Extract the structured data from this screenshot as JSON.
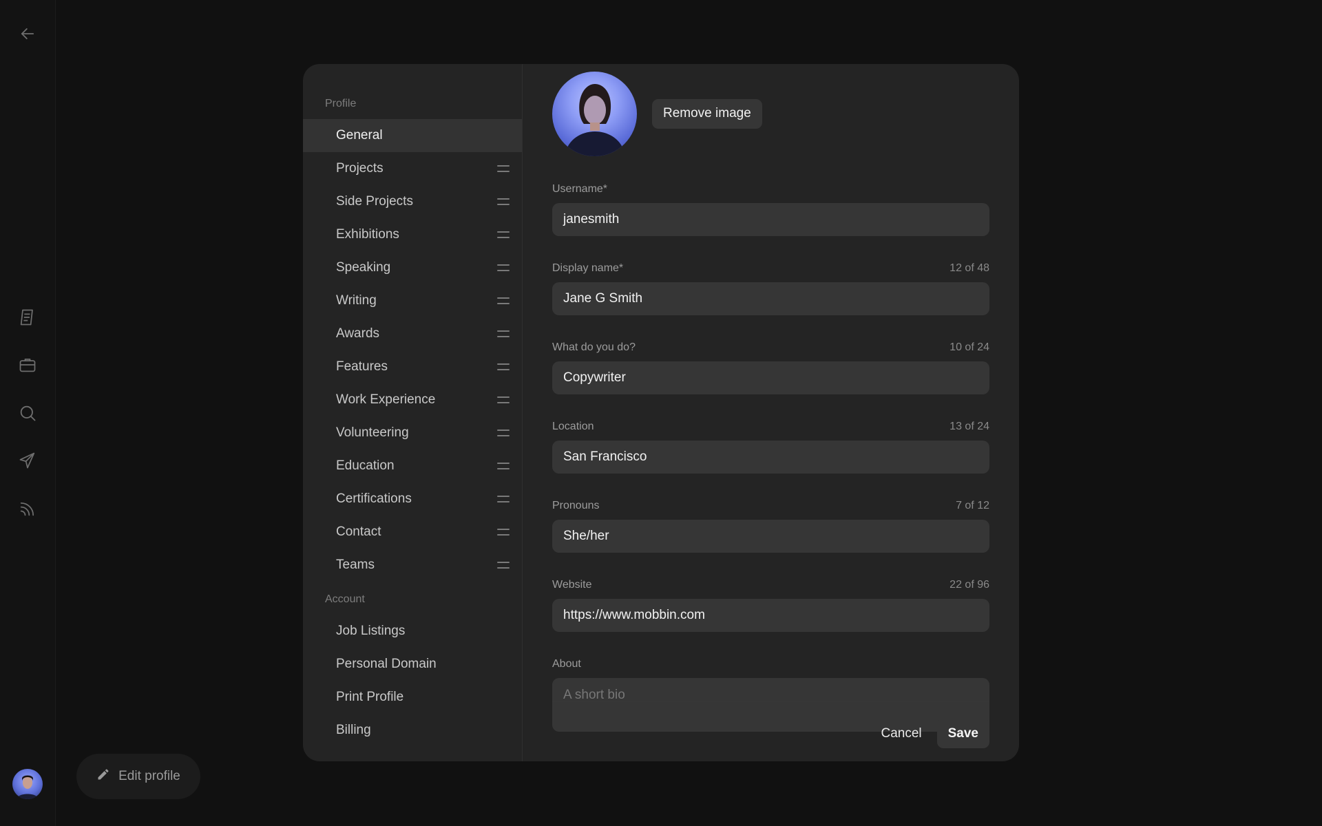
{
  "rail": {
    "icons": [
      "back-arrow-icon",
      "notes-icon",
      "briefcase-icon",
      "search-icon",
      "send-icon",
      "rss-icon"
    ]
  },
  "edit_profile": {
    "label": "Edit profile",
    "icon": "pencil-icon"
  },
  "sidebar": {
    "profile_heading": "Profile",
    "profile_items": [
      {
        "label": "General",
        "active": true
      },
      {
        "label": "Projects"
      },
      {
        "label": "Side Projects"
      },
      {
        "label": "Exhibitions"
      },
      {
        "label": "Speaking"
      },
      {
        "label": "Writing"
      },
      {
        "label": "Awards"
      },
      {
        "label": "Features"
      },
      {
        "label": "Work Experience"
      },
      {
        "label": "Volunteering"
      },
      {
        "label": "Education"
      },
      {
        "label": "Certifications"
      },
      {
        "label": "Contact"
      },
      {
        "label": "Teams"
      }
    ],
    "account_heading": "Account",
    "account_items": [
      {
        "label": "Job Listings"
      },
      {
        "label": "Personal Domain"
      },
      {
        "label": "Print Profile"
      },
      {
        "label": "Billing"
      }
    ]
  },
  "form": {
    "remove_image": "Remove image",
    "username": {
      "label": "Username*",
      "value": "janesmith"
    },
    "display_name": {
      "label": "Display name*",
      "count": "12 of 48",
      "value": "Jane G Smith"
    },
    "what_do_you_do": {
      "label": "What do you do?",
      "count": "10 of 24",
      "value": "Copywriter"
    },
    "location": {
      "label": "Location",
      "count": "13 of 24",
      "value": "San Francisco"
    },
    "pronouns": {
      "label": "Pronouns",
      "count": "7 of 12",
      "value": "She/her"
    },
    "website": {
      "label": "Website",
      "count": "22 of 96",
      "value": "https://www.mobbin.com"
    },
    "about": {
      "label": "About",
      "placeholder": "A short bio"
    },
    "cancel": "Cancel",
    "save": "Save"
  }
}
